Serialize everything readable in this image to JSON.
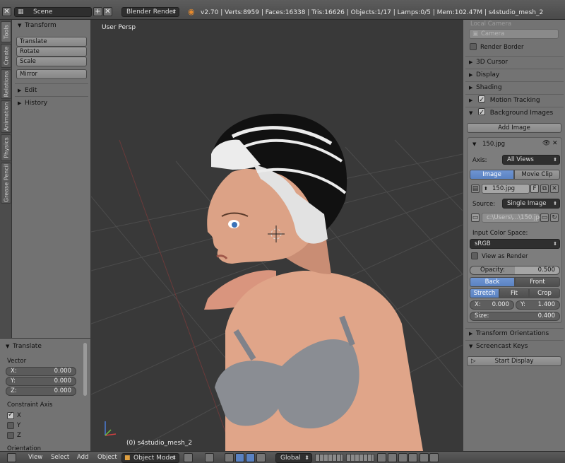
{
  "header": {
    "scene_field": "Scene",
    "renderer": "Blender Render",
    "stats": "v2.70 | Verts:8959 | Faces:16338 | Tris:16626 | Objects:1/17 | Lamps:0/5 | Mem:102.47M | s4studio_mesh_2"
  },
  "tabs": [
    "Tools",
    "Create",
    "Relations",
    "Animation",
    "Physics",
    "Grease Pencil"
  ],
  "tool_shelf": {
    "transform_title": "Transform",
    "buttons": [
      "Translate",
      "Rotate",
      "Scale",
      "Mirror"
    ],
    "edit_title": "Edit",
    "history_title": "History"
  },
  "operator": {
    "title": "Translate",
    "vector_label": "Vector",
    "x_label": "X:",
    "x_value": "0.000",
    "y_label": "Y:",
    "y_value": "0.000",
    "z_label": "Z:",
    "z_value": "0.000",
    "constraint_label": "Constraint Axis",
    "axis_x": "X",
    "axis_y": "Y",
    "axis_z": "Z",
    "orientation_label": "Orientation"
  },
  "viewport": {
    "view_label": "User Persp",
    "object_label": "(0) s4studio_mesh_2"
  },
  "properties": {
    "local_camera": "Local Camera",
    "camera_field": "Camera",
    "render_border": "Render Border",
    "cursor_3d": "3D Cursor",
    "display": "Display",
    "shading": "Shading",
    "motion_tracking": "Motion Tracking",
    "background_images": "Background Images",
    "add_image": "Add Image",
    "image_name": "150.jpg",
    "axis_label": "Axis:",
    "axis_value": "All Views",
    "tab_image": "Image",
    "tab_movie": "Movie Clip",
    "image_field": "150.jpg",
    "image_flag": "F",
    "source_label": "Source:",
    "source_value": "Single Image",
    "path_value": "c:\\Users\\...\\150.jpg",
    "color_space_label": "Input Color Space:",
    "color_space_value": "sRGB",
    "view_as_render": "View as Render",
    "opacity_label": "Opacity:",
    "opacity_value": "0.500",
    "back_label": "Back",
    "front_label": "Front",
    "stretch_label": "Stretch",
    "fit_label": "Fit",
    "crop_label": "Crop",
    "bx_label": "X:",
    "bx_value": "0.000",
    "by_label": "Y:",
    "by_value": "1.400",
    "size_label": "Size:",
    "size_value": "0.400",
    "transform_orientations": "Transform Orientations",
    "screencast_keys": "Screencast Keys",
    "start_display": "Start Display"
  },
  "bottom": {
    "menu_view": "View",
    "menu_select": "Select",
    "menu_add": "Add",
    "menu_object": "Object",
    "mode": "Object Mode",
    "orientation": "Global"
  },
  "colors": {
    "accent_blue": "#5a82c2",
    "panel_bg": "#737373",
    "viewport_bg": "#393939"
  }
}
